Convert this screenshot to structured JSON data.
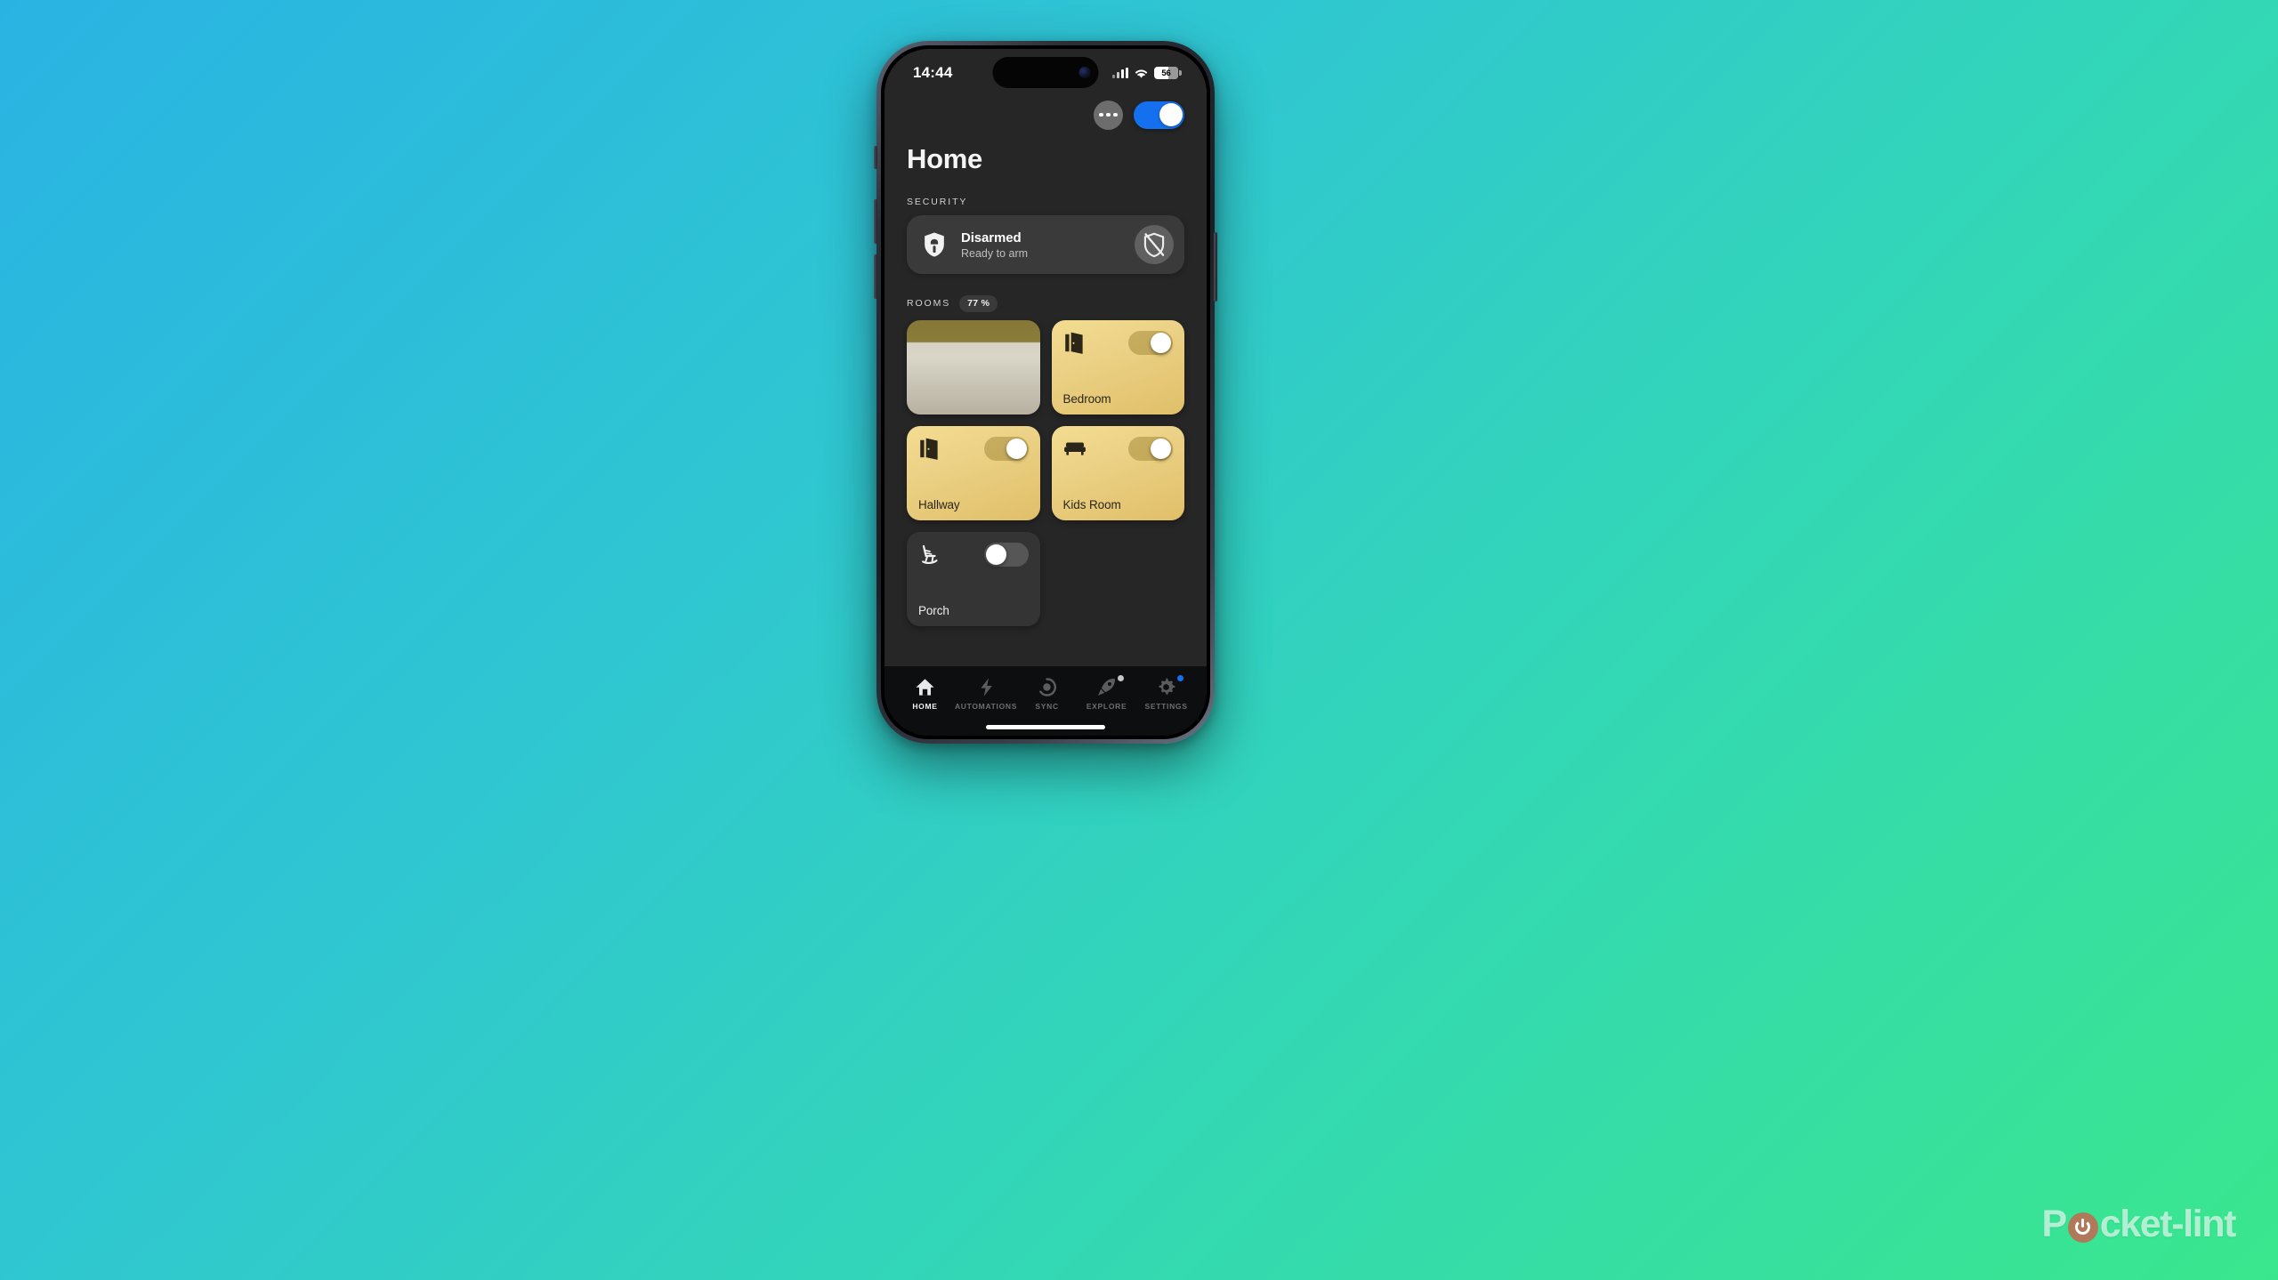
{
  "status_bar": {
    "time": "14:44",
    "battery_level": "56",
    "signal_icon": "cellular-signal-icon",
    "wifi_icon": "wifi-icon",
    "battery_icon": "battery-icon"
  },
  "header": {
    "title": "Home",
    "more_icon": "more-dots-icon",
    "master_toggle_state": "on",
    "accent_color": "#1570f0"
  },
  "security": {
    "section_label": "SECURITY",
    "status_title": "Disarmed",
    "status_subtitle": "Ready to arm",
    "shield_icon": "shield-home-icon",
    "action_icon": "shield-off-icon"
  },
  "rooms": {
    "section_label": "ROOMS",
    "percent_badge": "77 %",
    "items": [
      {
        "name": "",
        "icon": "",
        "state": "loading",
        "toggle": "none"
      },
      {
        "name": "Bedroom",
        "icon": "door-open-icon",
        "state": "on",
        "toggle": "on"
      },
      {
        "name": "Hallway",
        "icon": "door-open-icon",
        "state": "on",
        "toggle": "on"
      },
      {
        "name": "Kids Room",
        "icon": "sofa-icon",
        "state": "on",
        "toggle": "on"
      },
      {
        "name": "Porch",
        "icon": "rocking-chair-icon",
        "state": "off",
        "toggle": "off"
      }
    ]
  },
  "tab_bar": {
    "items": [
      {
        "label": "HOME",
        "icon": "home-icon",
        "active": true,
        "badge": "none"
      },
      {
        "label": "AUTOMATIONS",
        "icon": "lightning-icon",
        "active": false,
        "badge": "none"
      },
      {
        "label": "SYNC",
        "icon": "sync-icon",
        "active": false,
        "badge": "none"
      },
      {
        "label": "EXPLORE",
        "icon": "rocket-icon",
        "active": false,
        "badge": "#c6c6c6"
      },
      {
        "label": "SETTINGS",
        "icon": "gear-icon",
        "active": false,
        "badge": "#1570f0"
      }
    ]
  },
  "watermark": {
    "text_before": "P",
    "text_after": "cket-lint"
  }
}
